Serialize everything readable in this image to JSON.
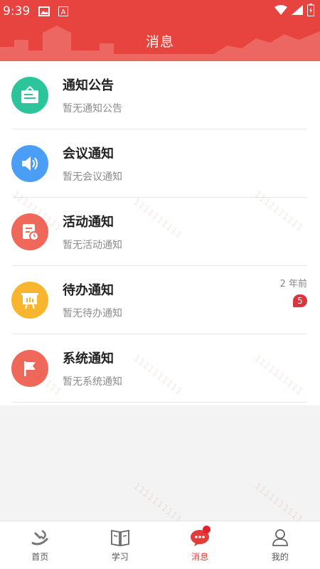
{
  "status_bar": {
    "time": "9:39",
    "icons": [
      "image-icon",
      "text-a-icon",
      "wifi-icon",
      "signal-icon",
      "battery-icon"
    ]
  },
  "header": {
    "title": "消息",
    "bg_color": "#e8443f"
  },
  "messages": [
    {
      "title": "通知公告",
      "subtitle": "暂无通知公告",
      "icon": "notice-board-icon",
      "color": "#2cc49a"
    },
    {
      "title": "会议通知",
      "subtitle": "暂无会议通知",
      "icon": "speaker-icon",
      "color": "#4a9ef5"
    },
    {
      "title": "活动通知",
      "subtitle": "暂无活动通知",
      "icon": "document-clock-icon",
      "color": "#f0685a"
    },
    {
      "title": "待办通知",
      "subtitle": "暂无待办通知",
      "icon": "presentation-board-icon",
      "color": "#f7b62d",
      "time": "2 年前",
      "badge": "5"
    },
    {
      "title": "系统通知",
      "subtitle": "暂无系统通知",
      "icon": "flag-icon",
      "color": "#f0685a"
    }
  ],
  "watermark": "1111111111",
  "tabbar": {
    "tabs": [
      {
        "label": "首页",
        "icon": "party-emblem-icon"
      },
      {
        "label": "学习",
        "icon": "book-icon"
      },
      {
        "label": "消息",
        "icon": "chat-bubble-icon",
        "active": true
      },
      {
        "label": "我的",
        "icon": "person-icon"
      }
    ]
  }
}
